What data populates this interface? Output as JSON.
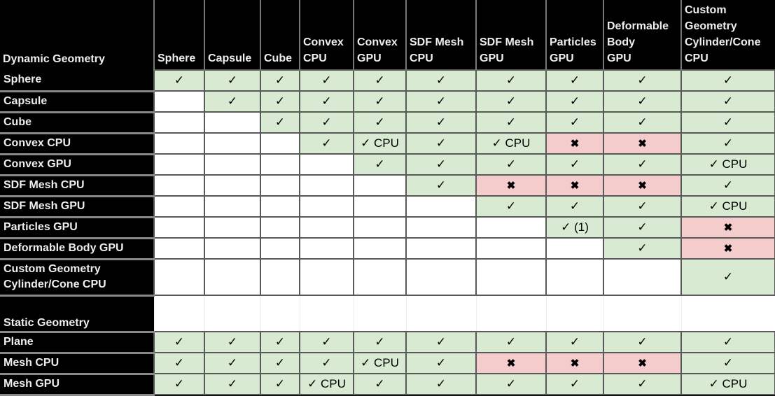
{
  "table": {
    "corner_label": "Dynamic Geometry",
    "columns": [
      [
        "Sphere"
      ],
      [
        "Capsule"
      ],
      [
        "Cube"
      ],
      [
        "Convex",
        "CPU"
      ],
      [
        "Convex",
        "GPU"
      ],
      [
        "SDF Mesh",
        "CPU"
      ],
      [
        "SDF Mesh",
        "GPU"
      ],
      [
        "Particles",
        "GPU"
      ],
      [
        "Deformable",
        "Body",
        "GPU"
      ],
      [
        "Custom",
        "Geometry",
        "Cylinder/Cone",
        "CPU"
      ]
    ],
    "legend": {
      "check": "✓",
      "cross": "✖",
      "blank": ""
    },
    "dynamic_rows": [
      {
        "label": [
          "Sphere"
        ],
        "cells": [
          "✓",
          "✓",
          "✓",
          "✓",
          "✓",
          "✓",
          "✓",
          "✓",
          "✓",
          "✓"
        ]
      },
      {
        "label": [
          "Capsule"
        ],
        "cells": [
          "",
          "✓",
          "✓",
          "✓",
          "✓",
          "✓",
          "✓",
          "✓",
          "✓",
          "✓"
        ]
      },
      {
        "label": [
          "Cube"
        ],
        "cells": [
          "",
          "",
          "✓",
          "✓",
          "✓",
          "✓",
          "✓",
          "✓",
          "✓",
          "✓"
        ]
      },
      {
        "label": [
          "Convex CPU"
        ],
        "cells": [
          "",
          "",
          "",
          "✓",
          "✓ CPU",
          "✓",
          "✓ CPU",
          "✖",
          "✖",
          "✓"
        ]
      },
      {
        "label": [
          "Convex GPU"
        ],
        "cells": [
          "",
          "",
          "",
          "",
          "✓",
          "✓",
          "✓",
          "✓",
          "✓",
          "✓ CPU"
        ]
      },
      {
        "label": [
          "SDF Mesh CPU"
        ],
        "cells": [
          "",
          "",
          "",
          "",
          "",
          "✓",
          "✖",
          "✖",
          "✖",
          "✓"
        ]
      },
      {
        "label": [
          "SDF Mesh GPU"
        ],
        "cells": [
          "",
          "",
          "",
          "",
          "",
          "",
          "✓",
          "✓",
          "✓",
          "✓ CPU"
        ]
      },
      {
        "label": [
          "Particles GPU"
        ],
        "cells": [
          "",
          "",
          "",
          "",
          "",
          "",
          "",
          "✓ (1)",
          "✓",
          "✖"
        ]
      },
      {
        "label": [
          "Deformable Body GPU"
        ],
        "cells": [
          "",
          "",
          "",
          "",
          "",
          "",
          "",
          "",
          "✓",
          "✖"
        ]
      },
      {
        "label": [
          "Custom Geometry",
          "Cylinder/Cone CPU"
        ],
        "cells": [
          "",
          "",
          "",
          "",
          "",
          "",
          "",
          "",
          "",
          "✓"
        ]
      }
    ],
    "static_section_label": "Static Geometry",
    "static_rows": [
      {
        "label": [
          "Plane"
        ],
        "cells": [
          "✓",
          "✓",
          "✓",
          "✓",
          "✓",
          "✓",
          "✓",
          "✓",
          "✓",
          "✓"
        ]
      },
      {
        "label": [
          "Mesh CPU"
        ],
        "cells": [
          "✓",
          "✓",
          "✓",
          "✓",
          "✓ CPU",
          "✓",
          "✖",
          "✖",
          "✖",
          "✓"
        ]
      },
      {
        "label": [
          "Mesh GPU"
        ],
        "cells": [
          "✓",
          "✓",
          "✓",
          "✓ CPU",
          "✓",
          "✓",
          "✓",
          "✓",
          "✓",
          "✓ CPU"
        ]
      }
    ],
    "colors": {
      "supported": "#d9ead3",
      "unsupported": "#f4cccc",
      "header_bg": "#000000"
    }
  }
}
